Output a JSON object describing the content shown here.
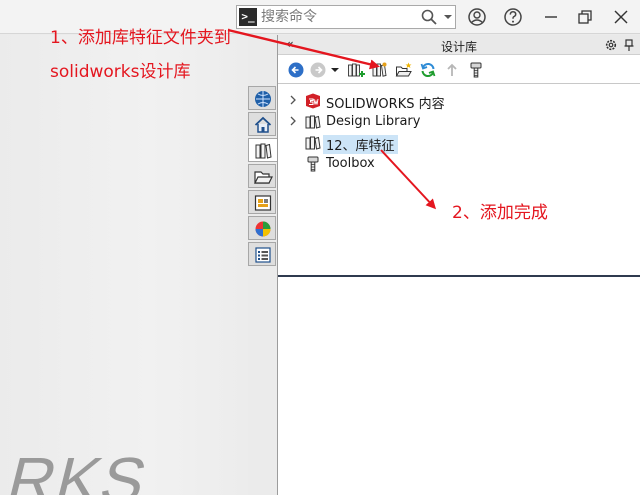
{
  "command_bar": {
    "prompt_glyph": ">_",
    "placeholder": "搜索命令"
  },
  "task_pane": {
    "title": "设计库",
    "collapse_glyph": "«",
    "tree": [
      {
        "label": "SOLIDWORKS 内容",
        "expandable": true,
        "icon": "solidworks-content-icon"
      },
      {
        "label": "Design Library",
        "expandable": true,
        "icon": "library-folder-icon"
      },
      {
        "label": "12、库特征",
        "expandable": false,
        "icon": "library-folder-icon",
        "selected": true
      },
      {
        "label": "Toolbox",
        "expandable": false,
        "icon": "toolbox-icon"
      }
    ]
  },
  "brand_watermark": "RKS",
  "annotations": {
    "step1": "1、添加库特征文件夹到solidworks设计库",
    "step2": "2、添加完成"
  },
  "colors": {
    "annotation": "#e4161f",
    "selection": "#cce4f7",
    "divider": "#2f3a4f"
  }
}
